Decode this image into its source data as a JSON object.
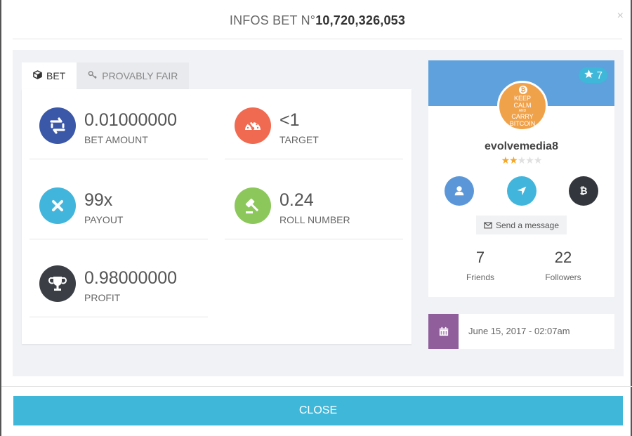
{
  "modal": {
    "title_prefix": "INFOS BET N°",
    "bet_number": "10,720,326,053",
    "close_x": "×"
  },
  "tabs": [
    {
      "label": "BET",
      "icon": "cube-icon"
    },
    {
      "label": "PROVABLY FAIR",
      "icon": "key-icon"
    }
  ],
  "stats": {
    "bet_amount": {
      "value": "0.01000000",
      "label": "BET AMOUNT",
      "color": "#3a57a8",
      "icon": "exchange-icon"
    },
    "target": {
      "value": "<1",
      "label": "TARGET",
      "color": "#ef6a51",
      "icon": "gauge-icon"
    },
    "payout": {
      "value": "99x",
      "label": "PAYOUT",
      "color": "#42b5dc",
      "icon": "times-icon"
    },
    "roll_number": {
      "value": "0.24",
      "label": "ROLL NUMBER",
      "color": "#8cc75c",
      "icon": "gavel-icon"
    },
    "profit": {
      "value": "0.98000000",
      "label": "PROFIT",
      "color": "#3b3f45",
      "icon": "trophy-icon"
    }
  },
  "profile": {
    "badge_count": "7",
    "avatar_text_1": "KEEP",
    "avatar_text_2": "CALM",
    "avatar_text_3": "AND",
    "avatar_text_4": "CARRY",
    "avatar_text_5": "BITCOIN",
    "username": "evolvemedia8",
    "rating": 2,
    "rating_max": 5,
    "send_message": "Send a message",
    "friends_count": "7",
    "friends_label": "Friends",
    "followers_count": "22",
    "followers_label": "Followers",
    "colors": {
      "banner": "#5fa1dc",
      "avatar": "#f0a24a",
      "badge": "#3fb7d8"
    }
  },
  "date": {
    "text": "June 15, 2017 - 02:07am",
    "icon": "calendar-icon",
    "color": "#8f5e9b"
  },
  "footer": {
    "close_label": "CLOSE",
    "color": "#3fb7d8"
  }
}
